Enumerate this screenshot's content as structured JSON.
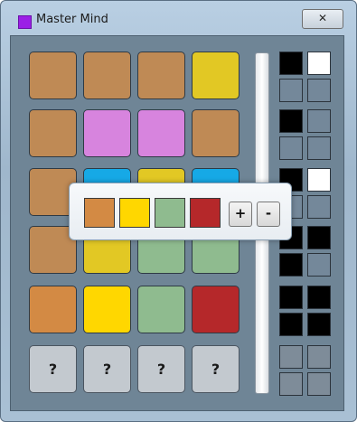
{
  "window": {
    "title": "Master Mind",
    "close_label": "✕"
  },
  "colors": {
    "brown": "#bf8a55",
    "yellow": "#e2c824",
    "pink": "#d784de",
    "blue": "#16a9e6",
    "orange": "#d38a44",
    "gold": "#ffd700",
    "green": "#8fbb8f",
    "red": "#b5282a",
    "feedback_black": "#000000",
    "feedback_white": "#ffffff",
    "feedback_empty": "#74889a"
  },
  "board": {
    "guesses": [
      [
        "brown",
        "brown",
        "brown",
        "yellow"
      ],
      [
        "brown",
        "pink",
        "pink",
        "brown"
      ],
      [
        "brown",
        "blue",
        "yellow",
        "blue"
      ],
      [
        "brown",
        "yellow",
        "green",
        "green"
      ],
      [
        "orange",
        "gold",
        "green",
        "red"
      ]
    ],
    "feedback": [
      [
        "black",
        "white",
        "empty",
        "empty"
      ],
      [
        "black",
        "empty",
        "empty",
        "empty"
      ],
      [
        "black",
        "white",
        "empty",
        "empty"
      ],
      [
        "black",
        "black",
        "black",
        "empty"
      ],
      [
        "black",
        "black",
        "black",
        "black"
      ]
    ],
    "hidden_symbol": "?",
    "hidden_count": 4
  },
  "picker": {
    "selected": [
      "orange",
      "gold",
      "green",
      "red"
    ],
    "plus_label": "+",
    "minus_label": "-"
  }
}
